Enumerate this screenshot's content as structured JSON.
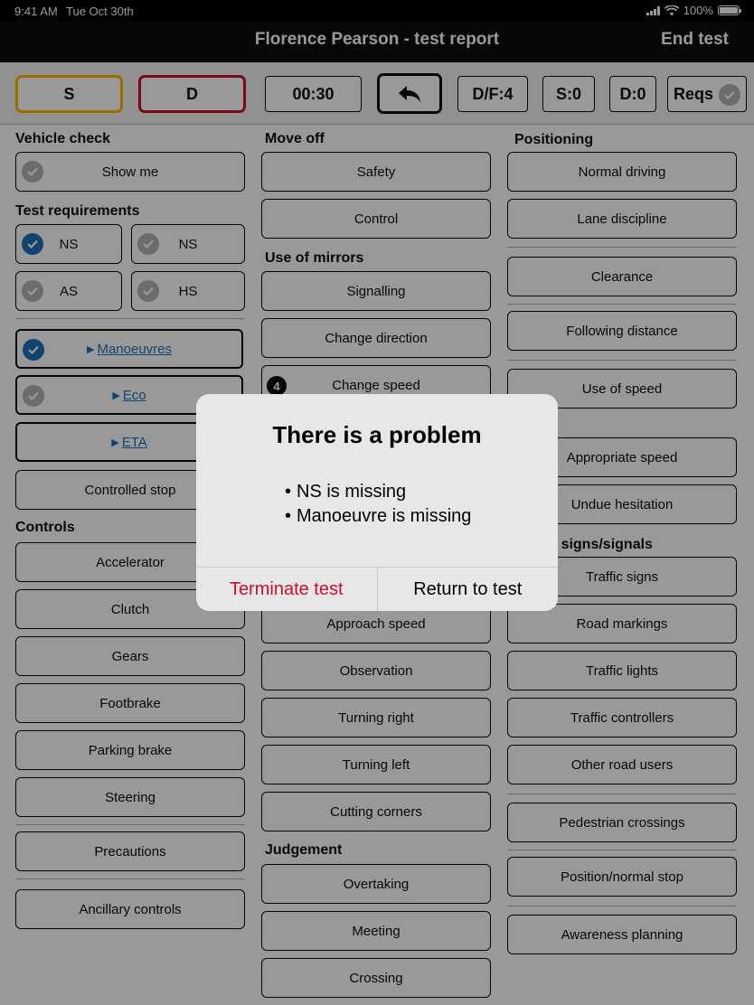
{
  "status_bar": {
    "time": "9:41 AM",
    "date": "Tue Oct 30th",
    "battery": "100%"
  },
  "nav": {
    "title": "Florence Pearson - test report",
    "end_test": "End test"
  },
  "toolbar": {
    "s": "S",
    "d": "D",
    "timer": "00:30",
    "df": "D/F:4",
    "serious": "S:0",
    "dangerous": "D:0",
    "reqs": "Reqs"
  },
  "col1": {
    "vehicle_check_title": "Vehicle check",
    "show_me": "Show me",
    "test_requirements_title": "Test requirements",
    "req_ns1": "NS",
    "req_ns2": "NS",
    "req_as": "AS",
    "req_hs": "HS",
    "manoeuvres": "Manoeuvres",
    "eco": "Eco",
    "eta": "ETA",
    "controlled_stop": "Controlled stop",
    "controls_title": "Controls",
    "controls": [
      "Accelerator",
      "Clutch",
      "Gears",
      "Footbrake",
      "Parking brake",
      "Steering"
    ],
    "precautions": "Precautions",
    "ancillary_controls": "Ancillary controls"
  },
  "col2": {
    "move_off_title": "Move off",
    "safety": "Safety",
    "control": "Control",
    "use_of_mirrors_title": "Use of mirrors",
    "signalling": "Signalling",
    "change_direction": "Change direction",
    "change_speed": "Change speed",
    "change_speed_faults": "4",
    "junction_items": [
      "Approach speed",
      "Observation",
      "Turning right",
      "Turning left",
      "Cutting corners"
    ],
    "judgement_title": "Judgement",
    "judgement_items": [
      "Overtaking",
      "Meeting",
      "Crossing"
    ]
  },
  "col3": {
    "positioning_title": "Positioning",
    "normal_driving": "Normal driving",
    "lane_discipline": "Lane discipline",
    "clearance": "Clearance",
    "following_distance": "Following distance",
    "use_of_speed": "Use of speed",
    "progress_title_partial": "ess",
    "appropriate_speed": "Appropriate speed",
    "undue_hesitation": "Undue hesitation",
    "response_title_partial": "nse to signs/signals",
    "signs_items": [
      "Traffic signs",
      "Road markings",
      "Traffic lights",
      "Traffic controllers",
      "Other road users"
    ],
    "pedestrian_crossings": "Pedestrian crossings",
    "position_normal_stop": "Position/normal stop",
    "awareness_planning": "Awareness planning"
  },
  "dialog": {
    "title": "There is a problem",
    "messages": [
      "NS is missing",
      "Manoeuvre is missing"
    ],
    "terminate": "Terminate test",
    "return": "Return to test"
  },
  "colors": {
    "accent_blue": "#1d70b8",
    "serious_yellow": "#ffb700",
    "dangerous_red": "#c8102e"
  }
}
